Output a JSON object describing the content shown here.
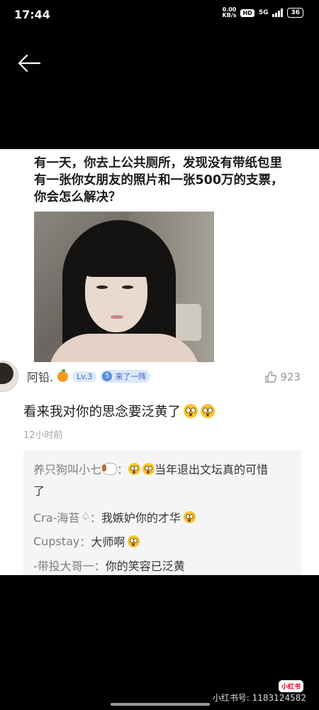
{
  "status_bar": {
    "time": "17:44",
    "net_speed_value": "0.00",
    "net_speed_unit": "KB/s",
    "hd": "HD",
    "network": "5G",
    "battery": "36"
  },
  "post": {
    "question": "有一天，你去上公共厕所，发现没有带纸包里有一张你女朋友的照片和一张500万的支票，你会怎么解决？"
  },
  "comment": {
    "username": "阿铅.",
    "level": "Lv.3",
    "badge_number": "5",
    "badge_text": "来了一阵",
    "likes": "923",
    "text": "看来我对你的思念要泛黄了",
    "time_ago": "12小时前"
  },
  "replies": [
    {
      "name": "养只狗叫小七",
      "text": "当年退出文坛真的可惜"
    },
    {
      "continuation": "了"
    },
    {
      "name": "Cra-海苔",
      "text": "我嫉妒你的才华"
    },
    {
      "name": "Cupstay",
      "text": "大师啊"
    },
    {
      "name": "-带投大哥一",
      "text": "你的笑容已泛黄"
    }
  ],
  "footer": {
    "logo": "小红书",
    "user_id": "小红书号: 1183124582"
  },
  "colors": {
    "background": "#000000",
    "card": "#ffffff",
    "reply_bg": "#f5f5f5",
    "badge_blue": "#3a63b8"
  }
}
